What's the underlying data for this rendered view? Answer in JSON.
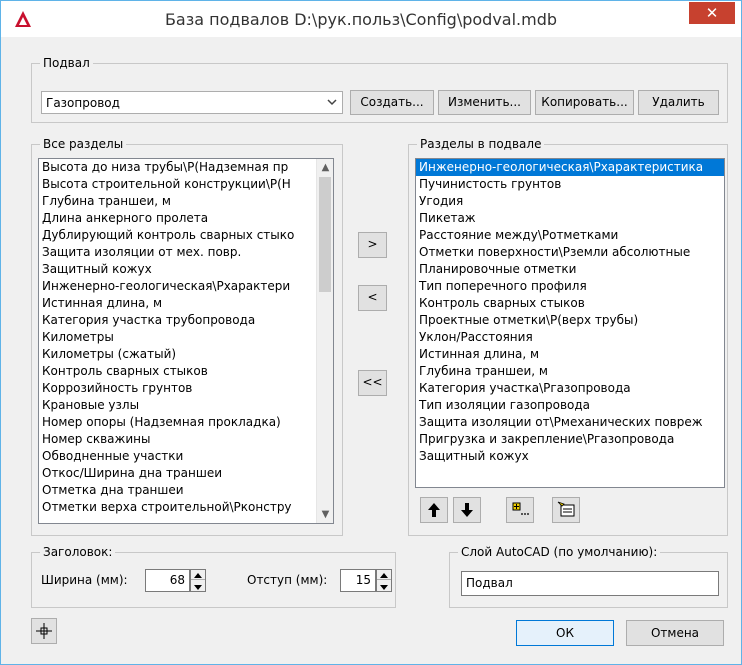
{
  "window": {
    "title": "База подвалов D:\\рук.польз\\Config\\podval.mdb",
    "close_label": "✕",
    "app_icon": "autocad-icon"
  },
  "podval_group": {
    "label": "Подвал",
    "combo_value": "Газопровод",
    "buttons": {
      "create": "Создать...",
      "edit": "Изменить...",
      "copy": "Копировать...",
      "delete": "Удалить"
    }
  },
  "all_sections": {
    "label": "Все разделы",
    "items": [
      "Высота до низа трубы\\Р(Надземная пр",
      "Высота строительной конструкции\\Р(Н",
      "Глубина траншеи, м",
      "Длина анкерного пролета",
      "Дублирующий контроль сварных стыко",
      "Защита изоляции от мех. повр.",
      "Защитный кожух",
      "Инженерно-геологическая\\Рхарактери",
      "Истинная длина, м",
      "Категория участка трубопровода",
      "Километры",
      "Километры (сжатый)",
      "Контроль сварных стыков",
      "Коррозийность грунтов",
      "Крановые узлы",
      "Номер опоры (Надземная прокладка)",
      "Номер скважины",
      "Обводненные участки",
      "Откос/Ширина дна траншеи",
      "Отметка дна траншеи",
      "Отметки верха строительной\\Рконстру"
    ]
  },
  "transfer_buttons": {
    "add": ">",
    "remove": "<",
    "remove_all": "<<"
  },
  "podval_sections": {
    "label": "Разделы в подвале",
    "selected_index": 0,
    "items": [
      "Инженерно-геологическая\\Рхарактеристика",
      "Пучинистость грунтов",
      "Угодия",
      "Пикетаж",
      "Расстояние между\\Ротметками",
      "Отметки поверхности\\Рземли абсолютные",
      "Планировочные отметки",
      "Тип поперечного профиля",
      "Контроль сварных стыков",
      "Проектные отметки\\Р(верх трубы)",
      "Уклон/Расстояния",
      "Истинная длина, м",
      "Глубина траншеи, м",
      "Категория участка\\Ргазопровода",
      "Тип изоляции газопровода",
      "Защита изоляции от\\Рмеханических повреж",
      "Пригрузка и закрепление\\Ргазопровода",
      "Защитный кожух"
    ],
    "tool_icons": [
      "move-up-icon",
      "move-down-icon",
      "add-section-icon",
      "edit-section-icon"
    ]
  },
  "header_group": {
    "label": "Заголовок:",
    "width_label": "Ширина (мм):",
    "width_value": "68",
    "indent_label": "Отступ (мм):",
    "indent_value": "15"
  },
  "layer_group": {
    "label": "Слой AutoCAD (по умолчанию):",
    "value": "Подвал"
  },
  "footer": {
    "pick_icon": "crosshair-icon",
    "ok": "ОК",
    "cancel": "Отмена"
  },
  "colors": {
    "selection": "#0078d7",
    "close_button": "#c7412f",
    "window_border": "#5fb3e8"
  }
}
